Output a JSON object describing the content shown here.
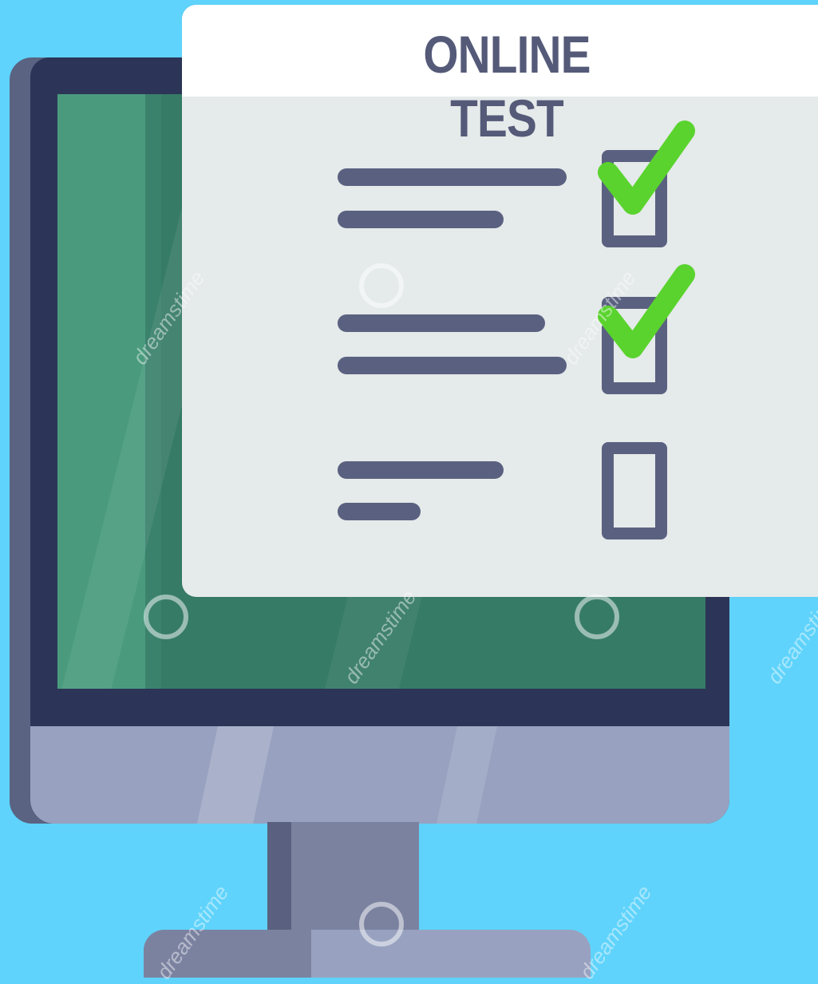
{
  "panel": {
    "title": "ONLINE TEST",
    "items": [
      {
        "checked": true
      },
      {
        "checked": true
      },
      {
        "checked": false
      }
    ]
  },
  "watermark": {
    "text": "dreamstime"
  },
  "colors": {
    "background": "#5fd3fb",
    "panel": "#e5eaea",
    "header": "#ffffff",
    "ink": "#5a6180",
    "check": "#5ad32e",
    "screen": "#3f8d72",
    "bezel": "#2c3557"
  },
  "icons": {
    "check": "check-icon",
    "monitor": "computer-monitor-icon"
  }
}
